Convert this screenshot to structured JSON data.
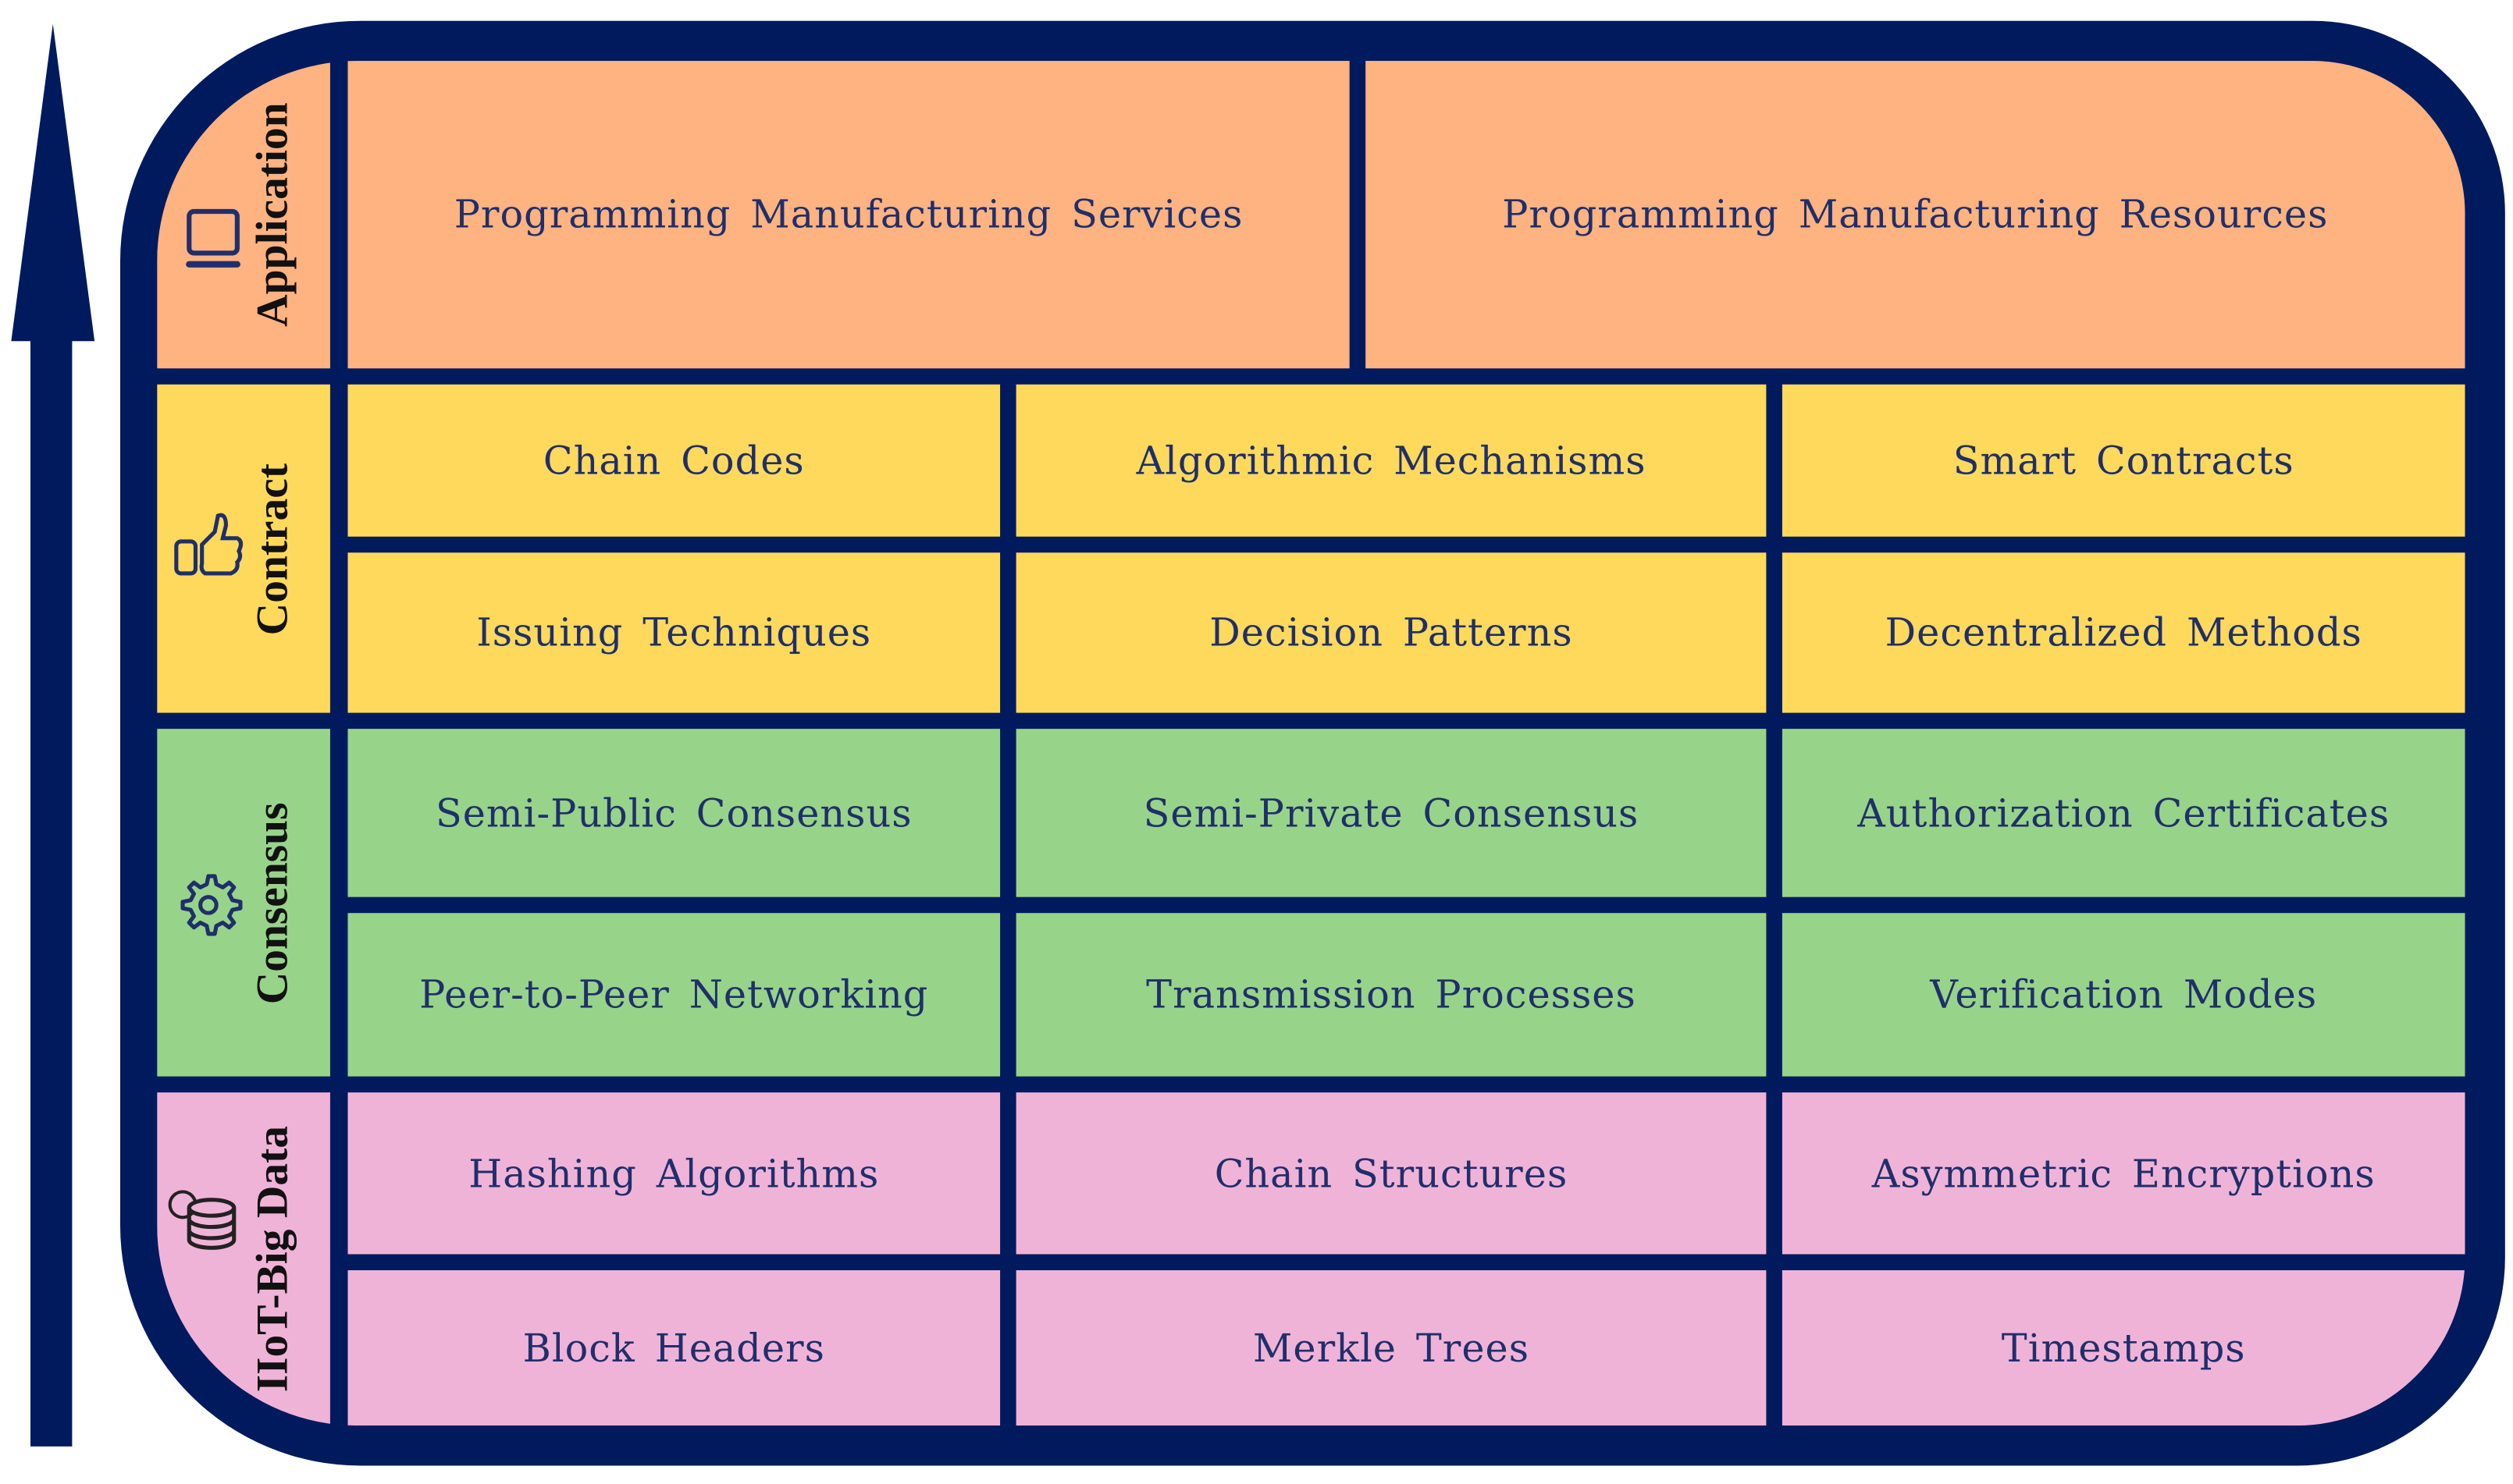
{
  "colors": {
    "frame": "#001a5e",
    "application": "#ffb380",
    "contract": "#ffd95c",
    "consensus": "#98d38a",
    "iiot": "#f0b3d8",
    "text": "#1f2f6b"
  },
  "layers": [
    {
      "label": "Application",
      "icon": "laptop-icon",
      "items": [
        "Programming Manufacturing Services",
        "Programming Manufacturing Resources"
      ]
    },
    {
      "label": "Contract",
      "icon": "thumbs-up-phone-icon",
      "items": [
        "Chain Codes",
        "Algorithmic Mechanisms",
        "Smart Contracts",
        "Issuing Techniques",
        "Decision Patterns",
        "Decentralized Methods"
      ]
    },
    {
      "label": "Consensus",
      "icon": "gear-icon",
      "items": [
        "Semi-Public Consensus",
        "Semi-Private Consensus",
        "Authorization Certificates",
        "Peer-to-Peer Networking",
        "Transmission Processes",
        "Verification Modes"
      ]
    },
    {
      "label": "IIoT-Big Data",
      "icon": "database-gear-icon",
      "items": [
        "Hashing Algorithms",
        "Chain Structures",
        "Asymmetric Encryptions",
        "Block Headers",
        "Merkle Trees",
        "Timestamps"
      ]
    }
  ]
}
